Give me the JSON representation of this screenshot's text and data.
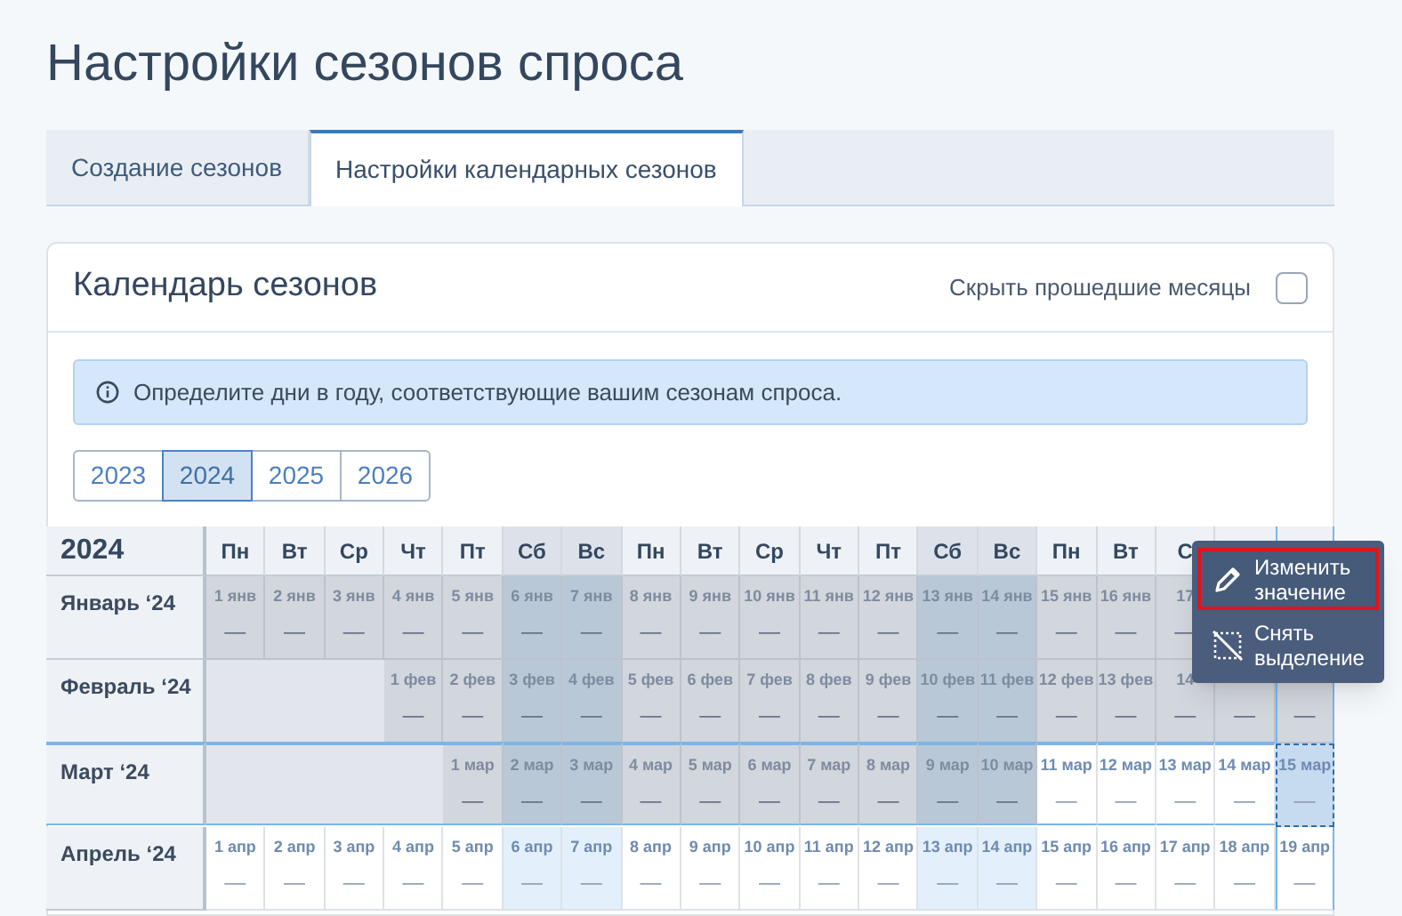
{
  "page_title": "Настройки сезонов спроса",
  "tabs": [
    {
      "label": "Создание сезонов",
      "selected": false
    },
    {
      "label": "Настройки календарных сезонов",
      "selected": true
    }
  ],
  "card": {
    "title": "Календарь сезонов",
    "hide_past": {
      "label": "Скрыть прошедшие месяцы",
      "checked": false
    },
    "info": "Определите дни в году, соответствующие вашим сезонам спроса.",
    "years": [
      {
        "label": "2023",
        "selected": false
      },
      {
        "label": "2024",
        "selected": true
      },
      {
        "label": "2025",
        "selected": false
      },
      {
        "label": "2026",
        "selected": false
      }
    ],
    "calendar": {
      "year_label": "2024",
      "days": [
        {
          "label": "Пн",
          "weekend": false
        },
        {
          "label": "Вт",
          "weekend": false
        },
        {
          "label": "Ср",
          "weekend": false
        },
        {
          "label": "Чт",
          "weekend": false
        },
        {
          "label": "Пт",
          "weekend": false
        },
        {
          "label": "Сб",
          "weekend": true
        },
        {
          "label": "Вс",
          "weekend": true
        },
        {
          "label": "Пн",
          "weekend": false
        },
        {
          "label": "Вт",
          "weekend": false
        },
        {
          "label": "Ср",
          "weekend": false
        },
        {
          "label": "Чт",
          "weekend": false
        },
        {
          "label": "Пт",
          "weekend": false
        },
        {
          "label": "Сб",
          "weekend": true
        },
        {
          "label": "Вс",
          "weekend": true
        },
        {
          "label": "Пн",
          "weekend": false
        },
        {
          "label": "Вт",
          "weekend": false
        },
        {
          "label": "С",
          "weekend": false
        }
      ],
      "months": [
        {
          "label": "Январь ‘24",
          "cells": [
            {
              "kind": "day",
              "date": "1 янв",
              "value": "—",
              "past": true,
              "selected": false
            },
            {
              "kind": "day",
              "date": "2 янв",
              "value": "—",
              "past": true,
              "selected": false
            },
            {
              "kind": "day",
              "date": "3 янв",
              "value": "—",
              "past": true,
              "selected": false
            },
            {
              "kind": "day",
              "date": "4 янв",
              "value": "—",
              "past": true,
              "selected": false
            },
            {
              "kind": "day",
              "date": "5 янв",
              "value": "—",
              "past": true,
              "selected": false
            },
            {
              "kind": "day",
              "date": "6 янв",
              "value": "—",
              "past": true,
              "selected": false
            },
            {
              "kind": "day",
              "date": "7 янв",
              "value": "—",
              "past": true,
              "selected": false
            },
            {
              "kind": "day",
              "date": "8 янв",
              "value": "—",
              "past": true,
              "selected": false
            },
            {
              "kind": "day",
              "date": "9 янв",
              "value": "—",
              "past": true,
              "selected": false
            },
            {
              "kind": "day",
              "date": "10 янв",
              "value": "—",
              "past": true,
              "selected": false
            },
            {
              "kind": "day",
              "date": "11 янв",
              "value": "—",
              "past": true,
              "selected": false
            },
            {
              "kind": "day",
              "date": "12 янв",
              "value": "—",
              "past": true,
              "selected": false
            },
            {
              "kind": "day",
              "date": "13 янв",
              "value": "—",
              "past": true,
              "selected": false
            },
            {
              "kind": "day",
              "date": "14 янв",
              "value": "—",
              "past": true,
              "selected": false
            },
            {
              "kind": "day",
              "date": "15 янв",
              "value": "—",
              "past": true,
              "selected": false
            },
            {
              "kind": "day",
              "date": "16 янв",
              "value": "—",
              "past": true,
              "selected": false
            },
            {
              "kind": "day",
              "date": "17",
              "value": "—",
              "past": true,
              "selected": false
            },
            {
              "kind": "covered"
            },
            {
              "kind": "covered"
            }
          ]
        },
        {
          "label": "Февраль ‘24",
          "cells": [
            {
              "kind": "blank"
            },
            {
              "kind": "blank"
            },
            {
              "kind": "blank"
            },
            {
              "kind": "day",
              "date": "1 фев",
              "value": "—",
              "past": true,
              "selected": false
            },
            {
              "kind": "day",
              "date": "2 фев",
              "value": "—",
              "past": true,
              "selected": false
            },
            {
              "kind": "day",
              "date": "3 фев",
              "value": "—",
              "past": true,
              "selected": false
            },
            {
              "kind": "day",
              "date": "4 фев",
              "value": "—",
              "past": true,
              "selected": false
            },
            {
              "kind": "day",
              "date": "5 фев",
              "value": "—",
              "past": true,
              "selected": false
            },
            {
              "kind": "day",
              "date": "6 фев",
              "value": "—",
              "past": true,
              "selected": false
            },
            {
              "kind": "day",
              "date": "7 фев",
              "value": "—",
              "past": true,
              "selected": false
            },
            {
              "kind": "day",
              "date": "8 фев",
              "value": "—",
              "past": true,
              "selected": false
            },
            {
              "kind": "day",
              "date": "9 фев",
              "value": "—",
              "past": true,
              "selected": false
            },
            {
              "kind": "day",
              "date": "10 фев",
              "value": "—",
              "past": true,
              "selected": false
            },
            {
              "kind": "day",
              "date": "11 фев",
              "value": "—",
              "past": true,
              "selected": false
            },
            {
              "kind": "day",
              "date": "12 фев",
              "value": "—",
              "past": true,
              "selected": false
            },
            {
              "kind": "day",
              "date": "13 фев",
              "value": "—",
              "past": true,
              "selected": false
            },
            {
              "kind": "day",
              "date": "14",
              "value": "—",
              "past": true,
              "selected": false
            },
            {
              "kind": "day",
              "value": "—",
              "past": true,
              "selected": false
            },
            {
              "kind": "day",
              "value": "—",
              "past": true,
              "selected": false
            }
          ]
        },
        {
          "label": "Март ‘24",
          "cells": [
            {
              "kind": "blank"
            },
            {
              "kind": "blank"
            },
            {
              "kind": "blank"
            },
            {
              "kind": "blank"
            },
            {
              "kind": "day",
              "date": "1 мар",
              "value": "—",
              "past": true,
              "selected": false
            },
            {
              "kind": "day",
              "date": "2 мар",
              "value": "—",
              "past": true,
              "selected": false
            },
            {
              "kind": "day",
              "date": "3 мар",
              "value": "—",
              "past": true,
              "selected": false
            },
            {
              "kind": "day",
              "date": "4 мар",
              "value": "—",
              "past": true,
              "selected": false
            },
            {
              "kind": "day",
              "date": "5 мар",
              "value": "—",
              "past": true,
              "selected": false
            },
            {
              "kind": "day",
              "date": "6 мар",
              "value": "—",
              "past": true,
              "selected": false
            },
            {
              "kind": "day",
              "date": "7 мар",
              "value": "—",
              "past": true,
              "selected": false
            },
            {
              "kind": "day",
              "date": "8 мар",
              "value": "—",
              "past": true,
              "selected": false
            },
            {
              "kind": "day",
              "date": "9 мар",
              "value": "—",
              "past": true,
              "selected": false
            },
            {
              "kind": "day",
              "date": "10 мар",
              "value": "—",
              "past": true,
              "selected": false
            },
            {
              "kind": "day",
              "date": "11 мар",
              "value": "—",
              "past": false,
              "selected": false
            },
            {
              "kind": "day",
              "date": "12 мар",
              "value": "—",
              "past": false,
              "selected": false
            },
            {
              "kind": "day",
              "date": "13 мар",
              "value": "—",
              "past": false,
              "selected": false
            },
            {
              "kind": "day",
              "date": "14 мар",
              "value": "—",
              "past": false,
              "selected": false
            },
            {
              "kind": "day",
              "date": "15 мар",
              "value": "—",
              "past": false,
              "selected": true
            }
          ]
        },
        {
          "label": "Апрель ‘24",
          "cells": [
            {
              "kind": "day",
              "date": "1 апр",
              "value": "—",
              "past": false,
              "selected": false
            },
            {
              "kind": "day",
              "date": "2 апр",
              "value": "—",
              "past": false,
              "selected": false
            },
            {
              "kind": "day",
              "date": "3 апр",
              "value": "—",
              "past": false,
              "selected": false
            },
            {
              "kind": "day",
              "date": "4 апр",
              "value": "—",
              "past": false,
              "selected": false
            },
            {
              "kind": "day",
              "date": "5 апр",
              "value": "—",
              "past": false,
              "selected": false
            },
            {
              "kind": "day",
              "date": "6 апр",
              "value": "—",
              "past": false,
              "selected": false
            },
            {
              "kind": "day",
              "date": "7 апр",
              "value": "—",
              "past": false,
              "selected": false
            },
            {
              "kind": "day",
              "date": "8 апр",
              "value": "—",
              "past": false,
              "selected": false
            },
            {
              "kind": "day",
              "date": "9 апр",
              "value": "—",
              "past": false,
              "selected": false
            },
            {
              "kind": "day",
              "date": "10 апр",
              "value": "—",
              "past": false,
              "selected": false
            },
            {
              "kind": "day",
              "date": "11 апр",
              "value": "—",
              "past": false,
              "selected": false
            },
            {
              "kind": "day",
              "date": "12 апр",
              "value": "—",
              "past": false,
              "selected": false
            },
            {
              "kind": "day",
              "date": "13 апр",
              "value": "—",
              "past": false,
              "selected": false
            },
            {
              "kind": "day",
              "date": "14 апр",
              "value": "—",
              "past": false,
              "selected": false
            },
            {
              "kind": "day",
              "date": "15 апр",
              "value": "—",
              "past": false,
              "selected": false
            },
            {
              "kind": "day",
              "date": "16 апр",
              "value": "—",
              "past": false,
              "selected": false
            },
            {
              "kind": "day",
              "date": "17 апр",
              "value": "—",
              "past": false,
              "selected": false
            },
            {
              "kind": "day",
              "date": "18 апр",
              "value": "—",
              "past": false,
              "selected": false
            },
            {
              "kind": "day",
              "date": "19 апр",
              "value": "—",
              "past": false,
              "selected": false
            }
          ]
        }
      ]
    },
    "context_menu": [
      {
        "kind": "edit",
        "label": "Изменить значение",
        "selected": true
      },
      {
        "kind": "clear",
        "label": "Снять выделение",
        "selected": false
      }
    ]
  }
}
